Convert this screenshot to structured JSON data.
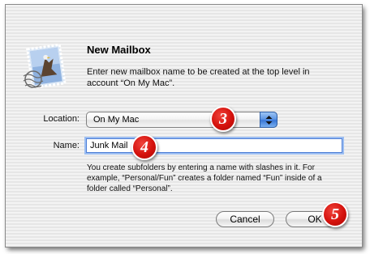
{
  "dialog": {
    "title": "New Mailbox",
    "message": "Enter new mailbox name to be created at the top level in account “On My Mac”.",
    "icon": "mail-stamp-eagle-icon"
  },
  "location": {
    "label": "Location:",
    "value": "On My Mac"
  },
  "name": {
    "label": "Name:",
    "value": "Junk Mail"
  },
  "hint": "You create subfolders by entering a name with slashes in it. For example, “Personal/Fun” creates a folder named “Fun” inside of a folder called “Personal”.",
  "buttons": {
    "cancel": "Cancel",
    "ok": "OK"
  },
  "callouts": {
    "step3": "3",
    "step4": "4",
    "step5": "5"
  },
  "colors": {
    "callout_red": "#d4110c",
    "focus_blue": "#4f7fd6",
    "popup_arrow_blue": "#3a77d6"
  }
}
